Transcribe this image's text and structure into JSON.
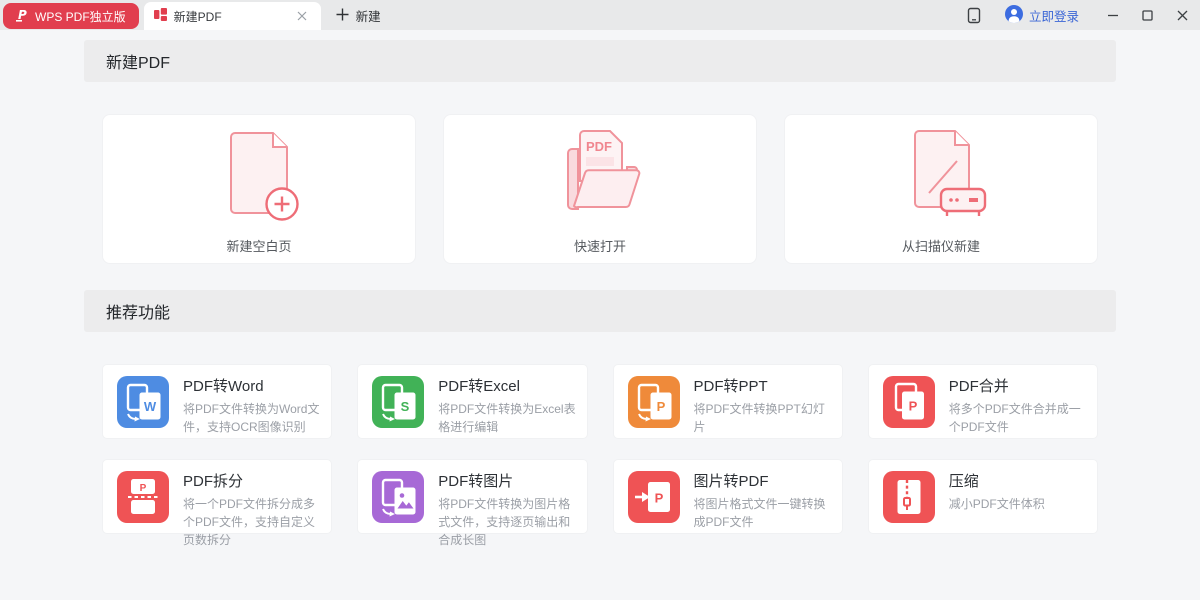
{
  "titlebar": {
    "brand": "WPS PDF独立版",
    "tab_label": "新建PDF",
    "new_tab_label": "新建",
    "login_label": "立即登录",
    "accent_color": "#e13e4e",
    "login_color": "#3b66d6",
    "icons": [
      "wps-pdf-logo-icon",
      "tab-grid-icon",
      "close-icon",
      "plus-icon",
      "device-icon",
      "avatar-icon",
      "minimize-icon",
      "maximize-icon",
      "window-close-icon"
    ]
  },
  "sections": {
    "new_pdf_title": "新建PDF",
    "recommended_title": "推荐功能"
  },
  "create_cards": [
    {
      "label": "新建空白页",
      "icon": "blank-page-icon"
    },
    {
      "label": "快速打开",
      "icon": "quick-open-folder-icon",
      "icon_text": "PDF"
    },
    {
      "label": "从扫描仪新建",
      "icon": "scanner-icon"
    }
  ],
  "features": [
    {
      "title": "PDF转Word",
      "desc": "将PDF文件转换为Word文件，支持OCR图像识别",
      "color": "#4e8ce2",
      "icon": "pdf-to-word",
      "style": "convert",
      "glyph": "W"
    },
    {
      "title": "PDF转Excel",
      "desc": "将PDF文件转换为Excel表格进行编辑",
      "color": "#41b257",
      "icon": "pdf-to-excel",
      "style": "convert",
      "glyph": "S"
    },
    {
      "title": "PDF转PPT",
      "desc": "将PDF文件转换PPT幻灯片",
      "color": "#ef8a3a",
      "icon": "pdf-to-ppt",
      "style": "convert",
      "glyph": "P"
    },
    {
      "title": "PDF合并",
      "desc": "将多个PDF文件合并成一个PDF文件",
      "color": "#ef5355",
      "icon": "pdf-merge",
      "style": "merge",
      "glyph": "P"
    },
    {
      "title": "PDF拆分",
      "desc": "将一个PDF文件拆分成多个PDF文件，支持自定义页数拆分",
      "color": "#ef5355",
      "icon": "pdf-split",
      "style": "split",
      "glyph": "P"
    },
    {
      "title": "PDF转图片",
      "desc": "将PDF文件转换为图片格式文件，支持逐页输出和合成长图",
      "color": "#a769d6",
      "icon": "pdf-to-image",
      "style": "convert",
      "glyph": "img"
    },
    {
      "title": "图片转PDF",
      "desc": "将图片格式文件一键转换成PDF文件",
      "color": "#ef5355",
      "icon": "image-to-pdf",
      "style": "arrow",
      "glyph": "P"
    },
    {
      "title": "压缩",
      "desc": "减小PDF文件体积",
      "color": "#ef5355",
      "icon": "pdf-compress",
      "style": "zip",
      "glyph": ""
    }
  ]
}
